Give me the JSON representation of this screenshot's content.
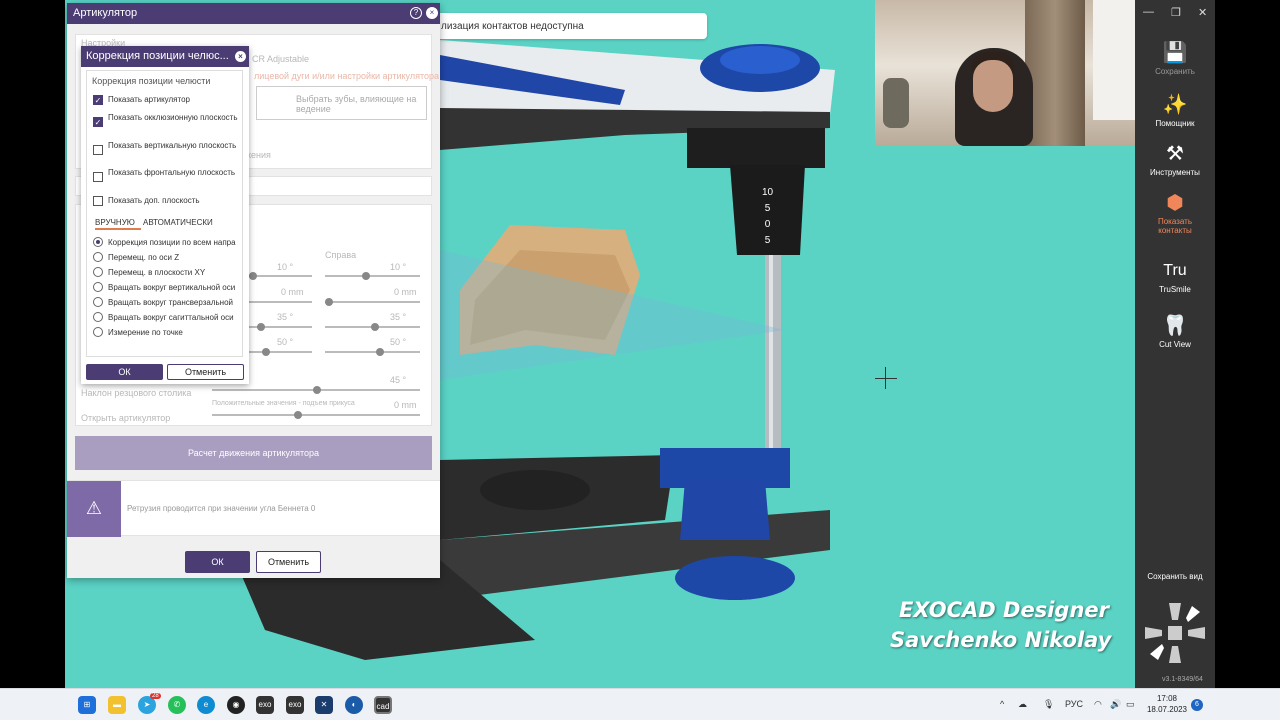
{
  "notification": "лизация контактов недоступна",
  "dialog": {
    "title": "Артикулятор",
    "help_icon": "?",
    "close_icon": "×",
    "ghost_texts": {
      "settings": "Настройки",
      "adjustable": "CR Adjustable",
      "facebow": "лицевой дуги и/или настройки артикулятора",
      "select_teeth": "Выбрать зубы, влияющие на ведение",
      "motion": "жения",
      "right": "Справа",
      "l1": "10 °",
      "r1": "10 °",
      "l2": "0 mm",
      "r2": "0 mm",
      "l3": "35 °",
      "r3": "35 °",
      "l4": "50 °",
      "r4": "50 °",
      "incisal_table": "Наклон резцового столика",
      "incisal_val": "45 °",
      "positive_values": "Положительные значения - подъем прикуса",
      "positive_val": "0 mm",
      "open_articulator": "Открыть артикулятор"
    },
    "calc_button": "Расчет движения артикулятора",
    "warning_text": "Ретрузия проводится при значении угла Беннета 0",
    "ok": "ОК",
    "cancel": "Отменить"
  },
  "popup": {
    "title": "Коррекция позиции челюс...",
    "section": "Коррекция позиции челюсти",
    "checkboxes": [
      {
        "label": "Показать артикулятор",
        "checked": true
      },
      {
        "label": "Показать окклюзионную плоскость",
        "checked": true
      },
      {
        "label": "Показать вертикальную плоскость",
        "checked": false
      },
      {
        "label": "Показать фронтальную плоскость",
        "checked": false
      },
      {
        "label": "Показать доп. плоскость",
        "checked": false
      }
    ],
    "tab_manual": "ВРУЧНУЮ",
    "tab_auto": "АВТОМАТИЧЕСКИ",
    "radios": [
      {
        "label": "Коррекция позиции по всем напра",
        "selected": true
      },
      {
        "label": "Перемещ. по оси Z",
        "selected": false
      },
      {
        "label": "Перемещ. в плоскости XY",
        "selected": false
      },
      {
        "label": "Вращать вокруг вертикальной оси",
        "selected": false
      },
      {
        "label": "Вращать вокруг трансверзальной",
        "selected": false
      },
      {
        "label": "Вращать вокруг сагиттальной оси",
        "selected": false
      },
      {
        "label": "Измерение по точке",
        "selected": false
      }
    ],
    "ok": "ОК",
    "cancel": "Отменить"
  },
  "toolbar": {
    "save": "Сохранить",
    "assistant": "Помощник",
    "tools": "Инструменты",
    "show_contacts": "Показать контакты",
    "trusmile": "TruSmile",
    "cut_view": "Cut View",
    "save_view": "Сохранить вид",
    "version": "v3.1-8349/64",
    "trusmile_logo": "Tru"
  },
  "scale_labels": [
    "10",
    "5",
    "0",
    "5"
  ],
  "watermark": {
    "line1": "EXOCAD Designer",
    "line2": "Savchenko Nikolay"
  },
  "taskbar": {
    "lang": "РУС",
    "time": "17:08",
    "date": "18.07.2023",
    "notifications": "6",
    "badge_count": "28",
    "app_exo1": "exo",
    "app_exo2": "exo",
    "app_cad": "cad"
  },
  "colors": {
    "accent": "#4b3d74",
    "highlight": "#f0875b",
    "viewport": "#5ad3c5"
  }
}
